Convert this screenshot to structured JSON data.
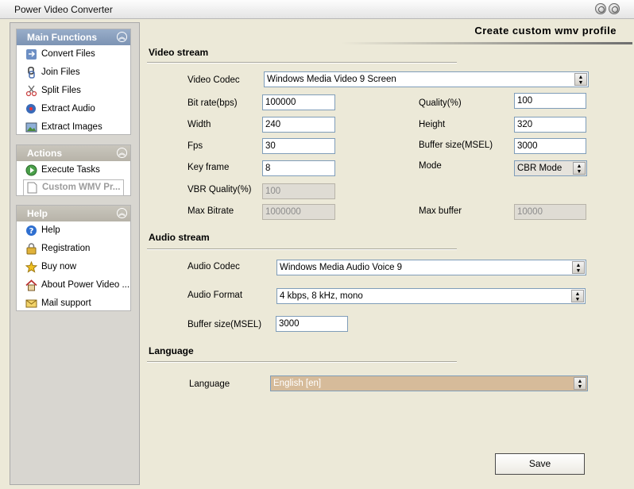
{
  "window": {
    "title": "Power Video Converter"
  },
  "sidebar": {
    "main_functions": {
      "title": "Main Functions",
      "items": [
        {
          "label": "Convert Files",
          "icon": "convert-files-icon"
        },
        {
          "label": "Join Files",
          "icon": "join-files-icon"
        },
        {
          "label": "Split Files",
          "icon": "split-files-icon"
        },
        {
          "label": "Extract Audio",
          "icon": "extract-audio-icon"
        },
        {
          "label": "Extract Images",
          "icon": "extract-images-icon"
        }
      ]
    },
    "actions": {
      "title": "Actions",
      "items": [
        {
          "label": "Execute Tasks",
          "icon": "execute-tasks-icon"
        },
        {
          "label": "Custom WMV Pr...",
          "icon": "document-icon"
        }
      ]
    },
    "help": {
      "title": "Help",
      "items": [
        {
          "label": "Help",
          "icon": "help-icon"
        },
        {
          "label": "Registration",
          "icon": "lock-icon"
        },
        {
          "label": "Buy now",
          "icon": "star-icon"
        },
        {
          "label": "About Power Video ...",
          "icon": "home-icon"
        },
        {
          "label": "Mail support",
          "icon": "mail-icon"
        }
      ]
    }
  },
  "main": {
    "page_title": "Create custom wmv profile",
    "video_stream": {
      "title": "Video stream",
      "video_codec": {
        "label": "Video Codec",
        "value": "Windows Media Video 9 Screen"
      },
      "bit_rate": {
        "label": "Bit rate(bps)",
        "value": "100000"
      },
      "quality": {
        "label": "Quality(%)",
        "value": "100"
      },
      "width": {
        "label": "Width",
        "value": "240"
      },
      "height": {
        "label": "Height",
        "value": "320"
      },
      "fps": {
        "label": "Fps",
        "value": "30"
      },
      "buffer_size": {
        "label": "Buffer size(MSEL)",
        "value": "3000"
      },
      "key_frame": {
        "label": "Key frame",
        "value": "8"
      },
      "mode": {
        "label": "Mode",
        "value": "CBR Mode"
      },
      "vbr_quality": {
        "label": "VBR Quality(%)",
        "value": "100"
      },
      "max_bitrate": {
        "label": "Max Bitrate",
        "value": "1000000"
      },
      "max_buffer": {
        "label": "Max buffer",
        "value": "10000"
      }
    },
    "audio_stream": {
      "title": "Audio stream",
      "audio_codec": {
        "label": "Audio Codec",
        "value": "Windows Media Audio Voice 9"
      },
      "audio_format": {
        "label": "Audio Format",
        "value": "4 kbps, 8 kHz, mono"
      },
      "buffer_size": {
        "label": "Buffer size(MSEL)",
        "value": "3000"
      }
    },
    "language": {
      "title": "Language",
      "language": {
        "label": "Language",
        "value": "English [en]"
      }
    },
    "save_label": "Save"
  }
}
